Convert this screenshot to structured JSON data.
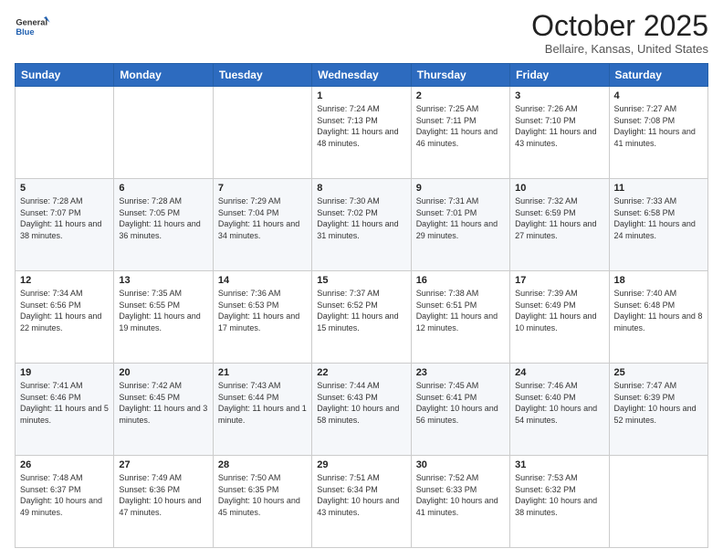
{
  "header": {
    "logo_line1": "General",
    "logo_line2": "Blue",
    "month_title": "October 2025",
    "location": "Bellaire, Kansas, United States"
  },
  "days_of_week": [
    "Sunday",
    "Monday",
    "Tuesday",
    "Wednesday",
    "Thursday",
    "Friday",
    "Saturday"
  ],
  "weeks": [
    [
      {
        "day": "",
        "sunrise": "",
        "sunset": "",
        "daylight": ""
      },
      {
        "day": "",
        "sunrise": "",
        "sunset": "",
        "daylight": ""
      },
      {
        "day": "",
        "sunrise": "",
        "sunset": "",
        "daylight": ""
      },
      {
        "day": "1",
        "sunrise": "Sunrise: 7:24 AM",
        "sunset": "Sunset: 7:13 PM",
        "daylight": "Daylight: 11 hours and 48 minutes."
      },
      {
        "day": "2",
        "sunrise": "Sunrise: 7:25 AM",
        "sunset": "Sunset: 7:11 PM",
        "daylight": "Daylight: 11 hours and 46 minutes."
      },
      {
        "day": "3",
        "sunrise": "Sunrise: 7:26 AM",
        "sunset": "Sunset: 7:10 PM",
        "daylight": "Daylight: 11 hours and 43 minutes."
      },
      {
        "day": "4",
        "sunrise": "Sunrise: 7:27 AM",
        "sunset": "Sunset: 7:08 PM",
        "daylight": "Daylight: 11 hours and 41 minutes."
      }
    ],
    [
      {
        "day": "5",
        "sunrise": "Sunrise: 7:28 AM",
        "sunset": "Sunset: 7:07 PM",
        "daylight": "Daylight: 11 hours and 38 minutes."
      },
      {
        "day": "6",
        "sunrise": "Sunrise: 7:28 AM",
        "sunset": "Sunset: 7:05 PM",
        "daylight": "Daylight: 11 hours and 36 minutes."
      },
      {
        "day": "7",
        "sunrise": "Sunrise: 7:29 AM",
        "sunset": "Sunset: 7:04 PM",
        "daylight": "Daylight: 11 hours and 34 minutes."
      },
      {
        "day": "8",
        "sunrise": "Sunrise: 7:30 AM",
        "sunset": "Sunset: 7:02 PM",
        "daylight": "Daylight: 11 hours and 31 minutes."
      },
      {
        "day": "9",
        "sunrise": "Sunrise: 7:31 AM",
        "sunset": "Sunset: 7:01 PM",
        "daylight": "Daylight: 11 hours and 29 minutes."
      },
      {
        "day": "10",
        "sunrise": "Sunrise: 7:32 AM",
        "sunset": "Sunset: 6:59 PM",
        "daylight": "Daylight: 11 hours and 27 minutes."
      },
      {
        "day": "11",
        "sunrise": "Sunrise: 7:33 AM",
        "sunset": "Sunset: 6:58 PM",
        "daylight": "Daylight: 11 hours and 24 minutes."
      }
    ],
    [
      {
        "day": "12",
        "sunrise": "Sunrise: 7:34 AM",
        "sunset": "Sunset: 6:56 PM",
        "daylight": "Daylight: 11 hours and 22 minutes."
      },
      {
        "day": "13",
        "sunrise": "Sunrise: 7:35 AM",
        "sunset": "Sunset: 6:55 PM",
        "daylight": "Daylight: 11 hours and 19 minutes."
      },
      {
        "day": "14",
        "sunrise": "Sunrise: 7:36 AM",
        "sunset": "Sunset: 6:53 PM",
        "daylight": "Daylight: 11 hours and 17 minutes."
      },
      {
        "day": "15",
        "sunrise": "Sunrise: 7:37 AM",
        "sunset": "Sunset: 6:52 PM",
        "daylight": "Daylight: 11 hours and 15 minutes."
      },
      {
        "day": "16",
        "sunrise": "Sunrise: 7:38 AM",
        "sunset": "Sunset: 6:51 PM",
        "daylight": "Daylight: 11 hours and 12 minutes."
      },
      {
        "day": "17",
        "sunrise": "Sunrise: 7:39 AM",
        "sunset": "Sunset: 6:49 PM",
        "daylight": "Daylight: 11 hours and 10 minutes."
      },
      {
        "day": "18",
        "sunrise": "Sunrise: 7:40 AM",
        "sunset": "Sunset: 6:48 PM",
        "daylight": "Daylight: 11 hours and 8 minutes."
      }
    ],
    [
      {
        "day": "19",
        "sunrise": "Sunrise: 7:41 AM",
        "sunset": "Sunset: 6:46 PM",
        "daylight": "Daylight: 11 hours and 5 minutes."
      },
      {
        "day": "20",
        "sunrise": "Sunrise: 7:42 AM",
        "sunset": "Sunset: 6:45 PM",
        "daylight": "Daylight: 11 hours and 3 minutes."
      },
      {
        "day": "21",
        "sunrise": "Sunrise: 7:43 AM",
        "sunset": "Sunset: 6:44 PM",
        "daylight": "Daylight: 11 hours and 1 minute."
      },
      {
        "day": "22",
        "sunrise": "Sunrise: 7:44 AM",
        "sunset": "Sunset: 6:43 PM",
        "daylight": "Daylight: 10 hours and 58 minutes."
      },
      {
        "day": "23",
        "sunrise": "Sunrise: 7:45 AM",
        "sunset": "Sunset: 6:41 PM",
        "daylight": "Daylight: 10 hours and 56 minutes."
      },
      {
        "day": "24",
        "sunrise": "Sunrise: 7:46 AM",
        "sunset": "Sunset: 6:40 PM",
        "daylight": "Daylight: 10 hours and 54 minutes."
      },
      {
        "day": "25",
        "sunrise": "Sunrise: 7:47 AM",
        "sunset": "Sunset: 6:39 PM",
        "daylight": "Daylight: 10 hours and 52 minutes."
      }
    ],
    [
      {
        "day": "26",
        "sunrise": "Sunrise: 7:48 AM",
        "sunset": "Sunset: 6:37 PM",
        "daylight": "Daylight: 10 hours and 49 minutes."
      },
      {
        "day": "27",
        "sunrise": "Sunrise: 7:49 AM",
        "sunset": "Sunset: 6:36 PM",
        "daylight": "Daylight: 10 hours and 47 minutes."
      },
      {
        "day": "28",
        "sunrise": "Sunrise: 7:50 AM",
        "sunset": "Sunset: 6:35 PM",
        "daylight": "Daylight: 10 hours and 45 minutes."
      },
      {
        "day": "29",
        "sunrise": "Sunrise: 7:51 AM",
        "sunset": "Sunset: 6:34 PM",
        "daylight": "Daylight: 10 hours and 43 minutes."
      },
      {
        "day": "30",
        "sunrise": "Sunrise: 7:52 AM",
        "sunset": "Sunset: 6:33 PM",
        "daylight": "Daylight: 10 hours and 41 minutes."
      },
      {
        "day": "31",
        "sunrise": "Sunrise: 7:53 AM",
        "sunset": "Sunset: 6:32 PM",
        "daylight": "Daylight: 10 hours and 38 minutes."
      },
      {
        "day": "",
        "sunrise": "",
        "sunset": "",
        "daylight": ""
      }
    ]
  ]
}
